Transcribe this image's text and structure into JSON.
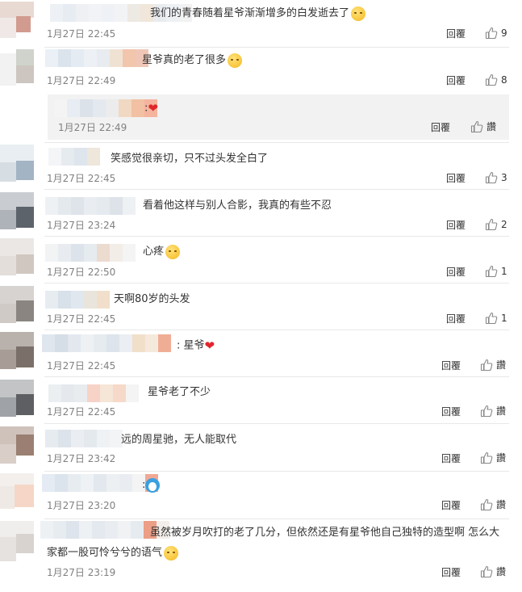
{
  "comments": [
    {
      "text": "我们的青春随着星爷渐渐增多的白发逝去了",
      "emoji": "emoji",
      "date": "1月27日 22:45",
      "reply": "回覆",
      "likes": "9"
    },
    {
      "text": "星爷真的老了很多",
      "emoji": "emoji",
      "date": "1月27日 22:49",
      "reply": "回覆",
      "likes": "8"
    },
    {
      "text": ":",
      "emoji": "heart",
      "date": "1月27日 22:49",
      "reply": "回覆",
      "likes": "讚",
      "nested": true
    },
    {
      "text": "笑感觉很亲切，只不过头发全白了",
      "emoji": "",
      "date": "1月27日 22:45",
      "reply": "回覆",
      "likes": "3"
    },
    {
      "text": "看着他这样与别人合影，我真的有些不忍",
      "emoji": "",
      "date": "1月27日 23:24",
      "reply": "回覆",
      "likes": "2"
    },
    {
      "text": "心疼",
      "emoji": "emoji",
      "date": "1月27日 22:50",
      "reply": "回覆",
      "likes": "1"
    },
    {
      "text": "天啊80岁的头发",
      "emoji": "",
      "date": "1月27日 22:45",
      "reply": "回覆",
      "likes": "1"
    },
    {
      "text": ": 星爷",
      "emoji": "heart",
      "date": "1月27日 22:45",
      "reply": "回覆",
      "likes": "讚"
    },
    {
      "text": "星爷老了不少",
      "emoji": "",
      "date": "1月27日 22:45",
      "reply": "回覆",
      "likes": "讚"
    },
    {
      "text": "远的周星驰，无人能取代",
      "emoji": "",
      "date": "1月27日 23:42",
      "reply": "回覆",
      "likes": "讚"
    },
    {
      "text": ":",
      "emoji": "doraemon",
      "date": "1月27日 23:20",
      "reply": "回覆",
      "likes": "讚"
    },
    {
      "text": "虽然被岁月吹打的老了几分，但依然还是有星爷他自己独特的造型啊 怎么大",
      "text2": "家都一股可怜兮兮的语气",
      "emoji": "emoji",
      "date": "1月27日 23:19",
      "reply": "回覆",
      "likes": "讚"
    }
  ],
  "colors": {
    "heart": "#e0262b",
    "date": "#808080",
    "separator": "#e8e8e8",
    "nested_bg": "#f2f2f2"
  },
  "icons": {
    "like": "thumbs-up-icon"
  }
}
